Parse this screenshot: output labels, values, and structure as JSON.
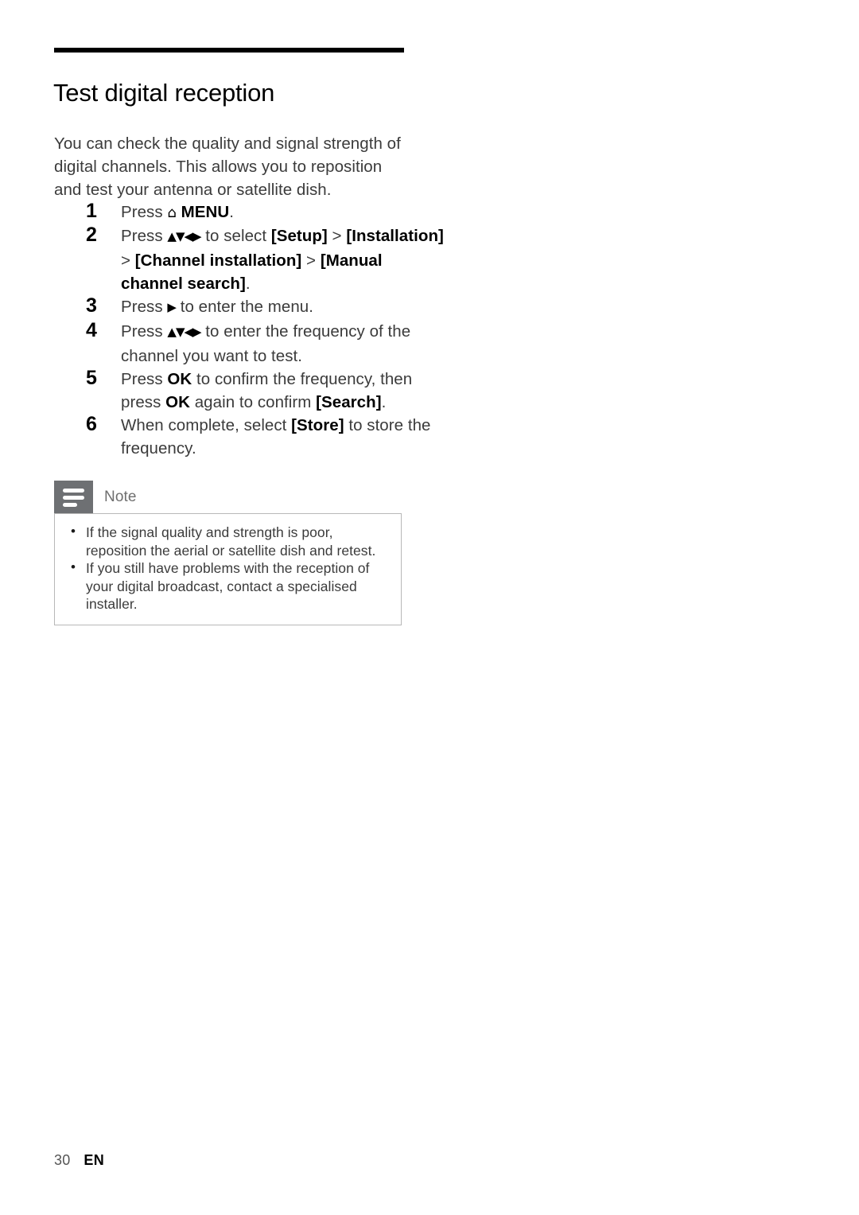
{
  "page": {
    "title": "Test digital reception",
    "intro": "You can check the quality and signal strength of digital channels. This allows you to reposition and test your antenna or satellite dish."
  },
  "steps": [
    {
      "number": "1",
      "parts": [
        {
          "type": "text",
          "value": "Press "
        },
        {
          "type": "icon",
          "value": "⌂",
          "icon_name": "home-menu-icon"
        },
        {
          "type": "bold",
          "value": " MENU"
        },
        {
          "type": "text",
          "value": "."
        }
      ],
      "plain": "Press ⌂ MENU."
    },
    {
      "number": "2",
      "parts": [
        {
          "type": "text",
          "value": "Press "
        },
        {
          "type": "icon",
          "value": "▲▼◀▶",
          "icon_name": "dpad-arrows-icon"
        },
        {
          "type": "text",
          "value": " to select "
        },
        {
          "type": "bold",
          "value": "[Setup]"
        },
        {
          "type": "text",
          "value": " > "
        },
        {
          "type": "bold",
          "value": "[Installation]"
        },
        {
          "type": "text",
          "value": " > "
        },
        {
          "type": "bold",
          "value": "[Channel installation]"
        },
        {
          "type": "text",
          "value": " > "
        },
        {
          "type": "bold",
          "value": "[Manual channel search]"
        },
        {
          "type": "text",
          "value": "."
        }
      ],
      "plain": "Press ▲▼◀▶ to select [Setup] > [Installation] > [Channel installation] > [Manual channel search]."
    },
    {
      "number": "3",
      "parts": [
        {
          "type": "text",
          "value": "Press "
        },
        {
          "type": "icon",
          "value": "▶",
          "icon_name": "right-arrow-icon"
        },
        {
          "type": "text",
          "value": " to enter the menu."
        }
      ],
      "plain": "Press ▶ to enter the menu."
    },
    {
      "number": "4",
      "parts": [
        {
          "type": "text",
          "value": "Press "
        },
        {
          "type": "icon",
          "value": "▲▼◀▶",
          "icon_name": "dpad-arrows-icon"
        },
        {
          "type": "text",
          "value": " to enter the frequency of the channel you want to test."
        }
      ],
      "plain": "Press ▲▼◀▶ to enter the frequency of the channel you want to test."
    },
    {
      "number": "5",
      "parts": [
        {
          "type": "text",
          "value": "Press "
        },
        {
          "type": "bold",
          "value": "OK"
        },
        {
          "type": "text",
          "value": " to confirm the frequency, then press "
        },
        {
          "type": "bold",
          "value": "OK"
        },
        {
          "type": "text",
          "value": " again to confirm "
        },
        {
          "type": "bold",
          "value": "[Search]"
        },
        {
          "type": "text",
          "value": "."
        }
      ],
      "plain": "Press OK to confirm the frequency, then press OK again to confirm [Search]."
    },
    {
      "number": "6",
      "parts": [
        {
          "type": "text",
          "value": "When complete, select "
        },
        {
          "type": "bold",
          "value": "[Store]"
        },
        {
          "type": "text",
          "value": " to store the frequency."
        }
      ],
      "plain": "When complete, select [Store] to store the frequency."
    }
  ],
  "note": {
    "label": "Note",
    "icon_name": "note-lines-icon",
    "bullets": [
      "If the signal quality and strength is poor, reposition the aerial or satellite dish and retest.",
      "If you still have problems with the reception of your digital broadcast, contact a specialised installer."
    ]
  },
  "footer": {
    "page_number": "30",
    "language": "EN"
  },
  "colors": {
    "rule": "#000000",
    "body_text": "#3b3b3b",
    "emphasis_text": "#000000",
    "note_tab": "#6e7073",
    "note_border": "#b8b8b8",
    "note_label": "#6f6f6f",
    "footer_page": "#555555"
  }
}
